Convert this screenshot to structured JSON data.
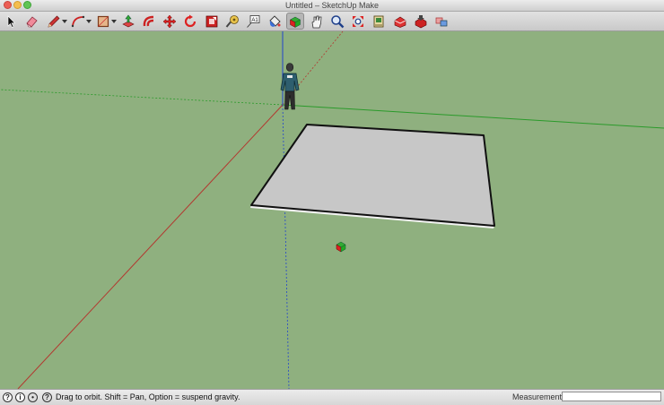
{
  "window": {
    "title": "Untitled – SketchUp Make"
  },
  "toolbar": {
    "tools": [
      {
        "name": "select-tool",
        "icon": "arrow-cursor-icon"
      },
      {
        "name": "eraser-tool",
        "icon": "eraser-icon"
      },
      {
        "name": "pencil-tool",
        "icon": "pencil-icon",
        "dropdown": true
      },
      {
        "name": "arc-tool",
        "icon": "arc-icon",
        "dropdown": true
      },
      {
        "name": "rectangle-tool",
        "icon": "rectangle-icon",
        "dropdown": true
      },
      {
        "name": "push-pull-tool",
        "icon": "push-pull-icon"
      },
      {
        "name": "offset-tool",
        "icon": "offset-icon"
      },
      {
        "name": "move-tool",
        "icon": "move-icon"
      },
      {
        "name": "rotate-tool",
        "icon": "rotate-icon"
      },
      {
        "name": "scale-tool",
        "icon": "scale-icon"
      },
      {
        "name": "tape-measure-tool",
        "icon": "tape-measure-icon"
      },
      {
        "name": "text-tool",
        "icon": "text-icon"
      },
      {
        "name": "paint-bucket-tool",
        "icon": "paint-bucket-icon"
      },
      {
        "name": "orbit-tool",
        "icon": "orbit-icon",
        "active": true
      },
      {
        "name": "pan-tool",
        "icon": "hand-icon"
      },
      {
        "name": "zoom-tool",
        "icon": "magnifier-icon"
      },
      {
        "name": "zoom-extents-tool",
        "icon": "zoom-extents-icon"
      },
      {
        "name": "previous-view-tool",
        "icon": "previous-view-icon"
      },
      {
        "name": "3d-warehouse-tool",
        "icon": "warehouse-icon"
      },
      {
        "name": "share-model-tool",
        "icon": "share-model-icon"
      },
      {
        "name": "extension-warehouse-tool",
        "icon": "extension-icon"
      }
    ]
  },
  "scene": {
    "sky_ground_color": "#8fb07f",
    "axis_colors": {
      "red": "#b3372f",
      "green": "#2a9a2a",
      "blue": "#2244cc"
    },
    "plane_fill": "#c7c7c7",
    "plane_edge": "#777777"
  },
  "statusbar": {
    "icons": [
      "geo-location-icon",
      "credits-icon",
      "user-account-icon",
      "instructor-icon"
    ],
    "message": "Drag to orbit. Shift = Pan, Option = suspend gravity.",
    "measurements_label": "Measurements",
    "measurements_value": ""
  }
}
